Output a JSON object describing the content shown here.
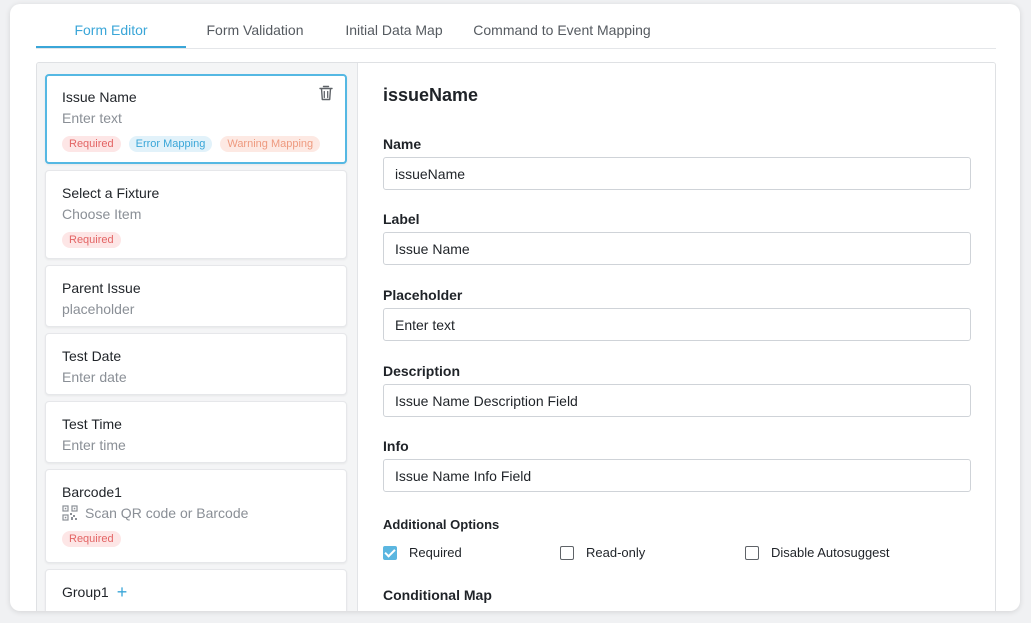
{
  "tabs": [
    {
      "label": "Form Editor"
    },
    {
      "label": "Form Validation"
    },
    {
      "label": "Initial Data Map"
    },
    {
      "label": "Command to Event Mapping"
    }
  ],
  "fields": [
    {
      "title": "Issue Name",
      "placeholder": "Enter text",
      "badges": [
        "Required",
        "Error Mapping",
        "Warning Mapping"
      ]
    },
    {
      "title": "Select a Fixture",
      "placeholder": "Choose Item",
      "badges": [
        "Required"
      ]
    },
    {
      "title": "Parent Issue",
      "placeholder": "placeholder"
    },
    {
      "title": "Test Date",
      "placeholder": "Enter date"
    },
    {
      "title": "Test Time",
      "placeholder": "Enter time"
    },
    {
      "title": "Barcode1",
      "placeholder": "Scan QR code or Barcode",
      "badges": [
        "Required"
      ]
    },
    {
      "title": "Group1"
    }
  ],
  "editor": {
    "heading": "issueName",
    "name_label": "Name",
    "name_value": "issueName",
    "label_label": "Label",
    "label_value": "Issue Name",
    "placeholder_label": "Placeholder",
    "placeholder_value": "Enter text",
    "description_label": "Description",
    "description_value": "Issue Name Description Field",
    "info_label": "Info",
    "info_value": "Issue Name Info Field",
    "additional_options_label": "Additional Options",
    "options": [
      {
        "label": "Required",
        "checked": true
      },
      {
        "label": "Read-only",
        "checked": false
      },
      {
        "label": "Disable Autosuggest",
        "checked": false
      }
    ],
    "conditional_map_label": "Conditional Map"
  },
  "colors": {
    "accent": "#3aa6d8",
    "selected_border": "#55b8e3",
    "required_badge": "#e36464",
    "error_badge": "#3aa6d8",
    "warning_badge": "#ee9a7f"
  },
  "icons": [
    "trash-icon",
    "qr-code-icon",
    "plus-icon",
    "checkbox-checked-icon"
  ]
}
